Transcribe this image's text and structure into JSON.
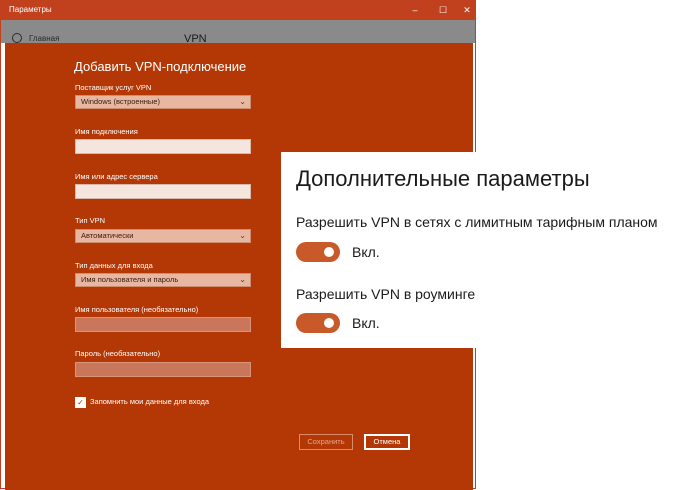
{
  "window": {
    "title": "Параметры",
    "controls": {
      "minimize": "–",
      "maximize": "☐",
      "close": "✕"
    },
    "home_label": "Главная",
    "page_title": "VPN"
  },
  "dialog": {
    "title": "Добавить VPN-подключение",
    "provider": {
      "label": "Поставщик услуг VPN",
      "value": "Windows (встроенные)"
    },
    "connection_name": {
      "label": "Имя подключения",
      "value": ""
    },
    "server": {
      "label": "Имя или адрес сервера",
      "value": ""
    },
    "vpn_type": {
      "label": "Тип VPN",
      "value": "Автоматически"
    },
    "signin_type": {
      "label": "Тип данных для входа",
      "value": "Имя пользователя и пароль"
    },
    "username": {
      "label": "Имя пользователя (необязательно)",
      "value": ""
    },
    "password": {
      "label": "Пароль (необязательно)",
      "value": ""
    },
    "remember": {
      "label": "Запомнить мои данные для входа",
      "checked": true
    },
    "save_label": "Сохранить",
    "cancel_label": "Отмена"
  },
  "advanced": {
    "title": "Дополнительные параметры",
    "options": [
      {
        "label": "Разрешить VPN в сетях с лимитным тарифным планом",
        "state": "Вкл.",
        "on": true
      },
      {
        "label": "Разрешить VPN в роуминге",
        "state": "Вкл.",
        "on": true
      }
    ]
  },
  "colors": {
    "accent": "#b33806",
    "toggle": "#c75a28"
  }
}
